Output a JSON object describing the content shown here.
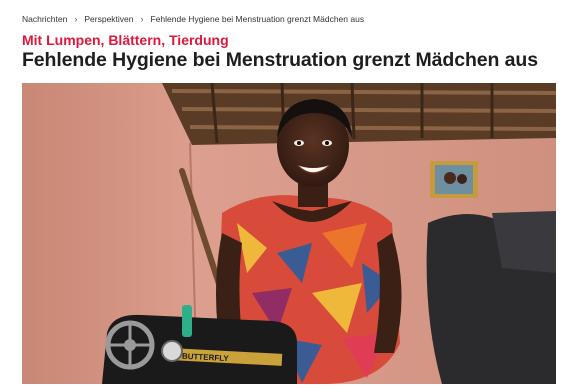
{
  "breadcrumb": {
    "items": [
      {
        "label": "Nachrichten"
      },
      {
        "label": "Perspektiven"
      },
      {
        "label": "Fehlende Hygiene bei Menstruation grenzt Mädchen aus"
      }
    ]
  },
  "article": {
    "kicker": "Mit Lumpen, Blättern, Tierdung",
    "title": "Fehlende Hygiene bei Menstruation grenzt Mädchen aus"
  },
  "hero_image": {
    "sewing_machine_brand": "BUTTERFLY"
  },
  "colors": {
    "kicker": "#e0173a",
    "wall": "#d8988a",
    "roof": "#6b4a2f"
  }
}
